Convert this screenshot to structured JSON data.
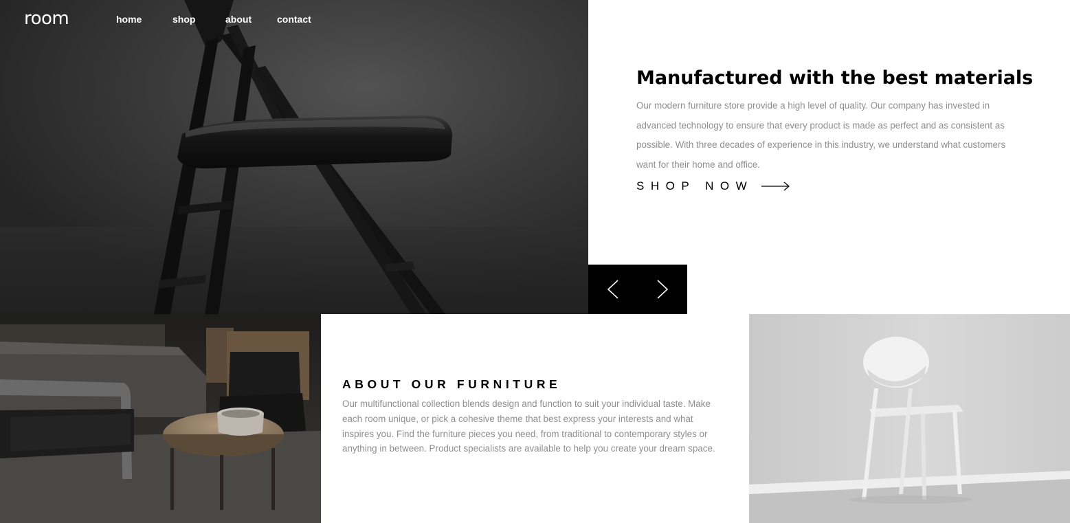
{
  "brand": {
    "logo_text": "room"
  },
  "nav": {
    "items": [
      {
        "label": "home"
      },
      {
        "label": "shop"
      },
      {
        "label": "about"
      },
      {
        "label": "contact"
      }
    ]
  },
  "hero": {
    "title": "Manufactured with the best materials",
    "text": "Our modern furniture store provide a high level of quality. Our company has invested in advanced technology to ensure that every product is made as perfect and as consistent as possible. With three decades of experience in this industry, we understand what customers want for their home and office.",
    "cta_label": "SHOP NOW",
    "cta_icon": "arrow-right-icon",
    "image": "dark-folding-chair-photo"
  },
  "slider": {
    "prev_icon": "chevron-left-icon",
    "next_icon": "chevron-right-icon"
  },
  "about": {
    "title": "ABOUT OUR FURNITURE",
    "text": "Our multifunctional collection blends design and function to suit your individual taste. Make each room unique, or pick a cohesive theme that best express your interests and what inspires you. Find the furniture pieces you need, from traditional to contemporary styles or anything in between. Product specialists are available to help you create your dream space.",
    "left_image": "dark-living-room-photo",
    "right_image": "white-chair-photo"
  },
  "colors": {
    "text_dark": "#000000",
    "text_muted": "#8e8e8e",
    "nav_text": "#ffffff",
    "slider_bg": "#000000"
  }
}
